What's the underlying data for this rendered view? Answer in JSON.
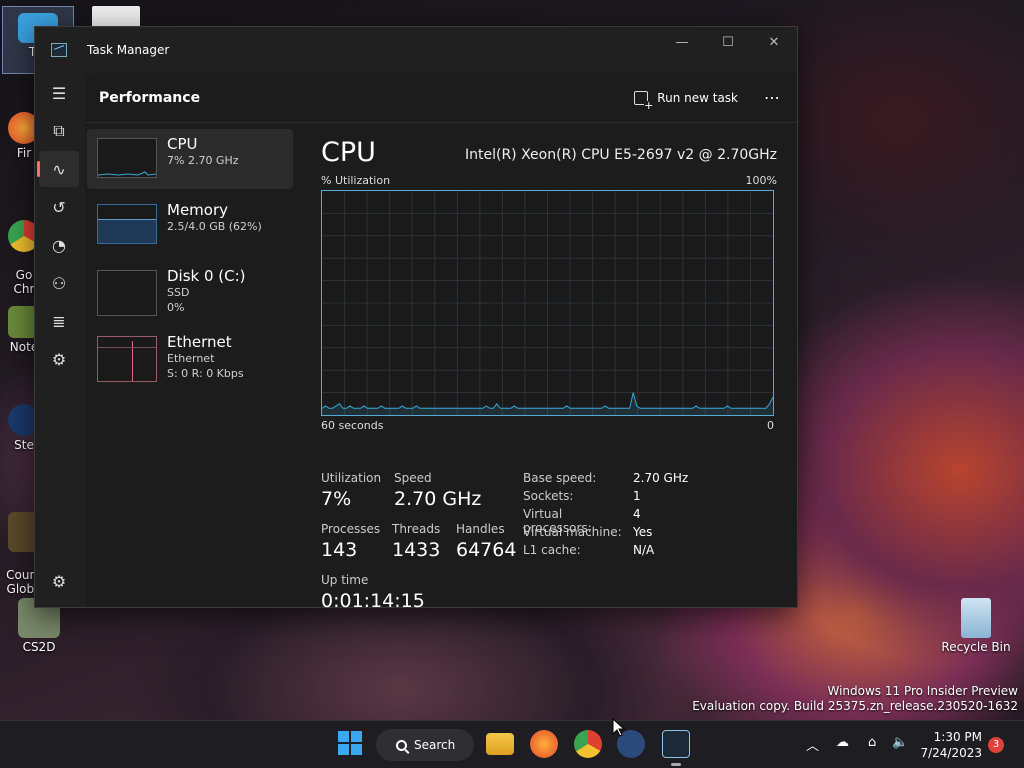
{
  "desktop": {
    "icons": [
      {
        "label": "Thi",
        "color": "#3aa0e0"
      },
      {
        "label": "Fir",
        "color": "#e86a2c"
      },
      {
        "label": "Go\nChr",
        "color": "#4caf50"
      },
      {
        "label": "Note",
        "color": "#6a8a3a"
      },
      {
        "label": "Ste",
        "color": "#1a3a6a"
      },
      {
        "label": "Count\nGloba",
        "color": "#5a4a2a"
      },
      {
        "label": "CS2D",
        "color": "#7a8a6a"
      }
    ],
    "recycle_bin": "Recycle Bin",
    "watermark_line1": "Windows 11 Pro Insider Preview",
    "watermark_line2": "Evaluation copy. Build 25375.zn_release.230520-1632"
  },
  "window": {
    "title": "Task Manager",
    "minimize_glyph": "—",
    "maximize_glyph": "☐",
    "close_glyph": "✕"
  },
  "nav": {
    "menu_icon": "☰",
    "items": [
      {
        "name": "processes",
        "glyph": "⧉"
      },
      {
        "name": "performance",
        "glyph": "∿"
      },
      {
        "name": "app-history",
        "glyph": "↺"
      },
      {
        "name": "startup",
        "glyph": "◔"
      },
      {
        "name": "users",
        "glyph": "⚇"
      },
      {
        "name": "details",
        "glyph": "≣"
      },
      {
        "name": "services",
        "glyph": "⚙"
      }
    ],
    "settings_glyph": "⚙"
  },
  "header": {
    "title": "Performance",
    "run_new_task": "Run new task",
    "more": "⋯"
  },
  "resources": [
    {
      "name": "CPU",
      "line1": "7% 2.70 GHz",
      "line2": ""
    },
    {
      "name": "Memory",
      "line1": "2.5/4.0 GB (62%)",
      "line2": ""
    },
    {
      "name": "Disk 0 (C:)",
      "line1": "SSD",
      "line2": "0%"
    },
    {
      "name": "Ethernet",
      "line1": "Ethernet",
      "line2": "S: 0 R: 0 Kbps"
    }
  ],
  "cpu": {
    "title": "CPU",
    "model": "Intel(R) Xeon(R) CPU E5-2697 v2 @ 2.70GHz",
    "util_label": "% Utilization",
    "util_max": "100%",
    "time_label": "60 seconds",
    "time_zero": "0",
    "graph_color": "#3aa8d8",
    "graph_samples": [
      3,
      4,
      3,
      3,
      4,
      5,
      3,
      3,
      4,
      3,
      3,
      3,
      4,
      3,
      3,
      3,
      3,
      4,
      3,
      3,
      3,
      3,
      3,
      4,
      3,
      3,
      3,
      4,
      3,
      3,
      3,
      3,
      3,
      3,
      3,
      3,
      3,
      3,
      3,
      3,
      3,
      3,
      3,
      3,
      3,
      3,
      3,
      4,
      3,
      3,
      5,
      3,
      3,
      3,
      3,
      4,
      3,
      3,
      3,
      3,
      3,
      3,
      3,
      3,
      3,
      3,
      3,
      3,
      3,
      3,
      4,
      3,
      3,
      3,
      3,
      3,
      3,
      3,
      3,
      3,
      3,
      4,
      3,
      3,
      3,
      3,
      3,
      3,
      3,
      10,
      4,
      3,
      3,
      3,
      3,
      3,
      3,
      3,
      3,
      3,
      3,
      3,
      3,
      3,
      3,
      3,
      3,
      4,
      3,
      3,
      3,
      3,
      3,
      3,
      3,
      3,
      4,
      3,
      3,
      3,
      3,
      3,
      3,
      3,
      3,
      3,
      3,
      3,
      5,
      8
    ],
    "stats": {
      "utilization_label": "Utilization",
      "utilization": "7%",
      "speed_label": "Speed",
      "speed": "2.70 GHz",
      "processes_label": "Processes",
      "processes": "143",
      "threads_label": "Threads",
      "threads": "1433",
      "handles_label": "Handles",
      "handles": "64764",
      "uptime_label": "Up time",
      "uptime": "0:01:14:15"
    },
    "info": [
      {
        "key": "Base speed:",
        "value": "2.70 GHz"
      },
      {
        "key": "Sockets:",
        "value": "1"
      },
      {
        "key": "Virtual processors:",
        "value": "4"
      },
      {
        "key": "Virtual machine:",
        "value": "Yes"
      },
      {
        "key": "L1 cache:",
        "value": "N/A"
      }
    ]
  },
  "taskbar": {
    "search_label": "Search",
    "time": "1:30 PM",
    "date": "7/24/2023",
    "notification_count": "3",
    "tray_chevron": "︿",
    "tray_network": "⌂",
    "tray_volume": "🔈"
  }
}
